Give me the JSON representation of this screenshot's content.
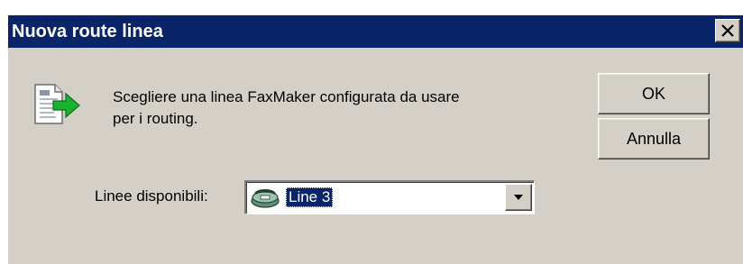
{
  "dialog": {
    "title": "Nuova route linea",
    "close_icon": "close-icon",
    "message_lines": [
      "Scegliere una linea FaxMaker configurata da usare",
      "per i routing."
    ],
    "message_icon": "document-arrow-icon",
    "buttons": {
      "ok": "OK",
      "cancel": "Annulla"
    },
    "lines_label": "Linee disponibili:",
    "lines_select": {
      "selected": "Line 3",
      "item_icon": "fax-line-icon"
    }
  },
  "colors": {
    "titlebar": "#0a246a",
    "face": "#d4d0c8",
    "selection": "#0a246a",
    "arrow_green": "#19b32e"
  }
}
